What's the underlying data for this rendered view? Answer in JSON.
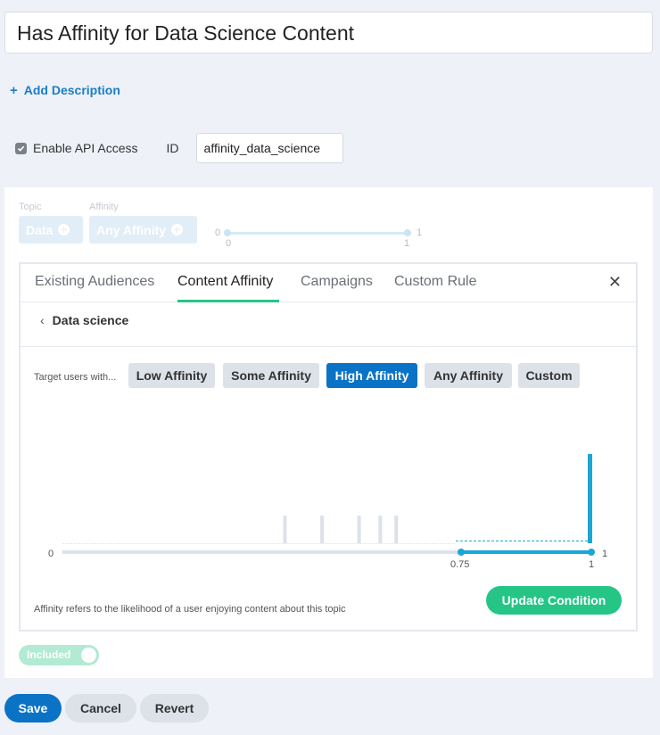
{
  "condition_title": "Has Affinity for Data Science Content",
  "add_description": "Add Description",
  "api": {
    "enable_label": "Enable API Access",
    "checked": true,
    "id_label": "ID",
    "id_value": "affinity_data_science"
  },
  "condition_row": {
    "topic_label": "Topic",
    "topic_value": "Data",
    "affinity_label": "Affinity",
    "affinity_value": "Any Affinity",
    "range_min": "0",
    "range_max": "1",
    "range_low": "0",
    "range_high": "1"
  },
  "editor": {
    "tabs": [
      {
        "label": "Existing Audiences"
      },
      {
        "label": "Content Affinity"
      },
      {
        "label": "Campaigns"
      },
      {
        "label": "Custom Rule"
      }
    ],
    "active_tab": "Content Affinity",
    "breadcrumb": "Data science",
    "target_label": "Target users with...",
    "affinity_options": [
      {
        "label": "Low Affinity"
      },
      {
        "label": "Some Affinity"
      },
      {
        "label": "High Affinity"
      },
      {
        "label": "Any Affinity"
      },
      {
        "label": "Custom"
      }
    ],
    "selected_affinity": "High Affinity",
    "histogram": {
      "axis_min_label": "0",
      "axis_max_label": "1",
      "range_low_label": "0.75",
      "range_high_label": "1",
      "range": [
        0.75,
        1.0
      ],
      "bars": [
        {
          "x": 0.42,
          "h": 0.31
        },
        {
          "x": 0.49,
          "h": 0.31
        },
        {
          "x": 0.56,
          "h": 0.31
        },
        {
          "x": 0.6,
          "h": 0.31
        },
        {
          "x": 0.63,
          "h": 0.31
        },
        {
          "x": 1.0,
          "h": 1.0
        }
      ]
    },
    "footer_note": "Affinity refers to the likelihood of a user enjoying content about this topic",
    "update_button": "Update Condition"
  },
  "toggle_label": "Included",
  "buttons": {
    "save": "Save",
    "cancel": "Cancel",
    "revert": "Revert"
  },
  "colors": {
    "primary": "#0b73c6",
    "accent_green": "#25c586",
    "histogram_range": "#1ba6d8",
    "bar_gray": "#dde1ea"
  }
}
